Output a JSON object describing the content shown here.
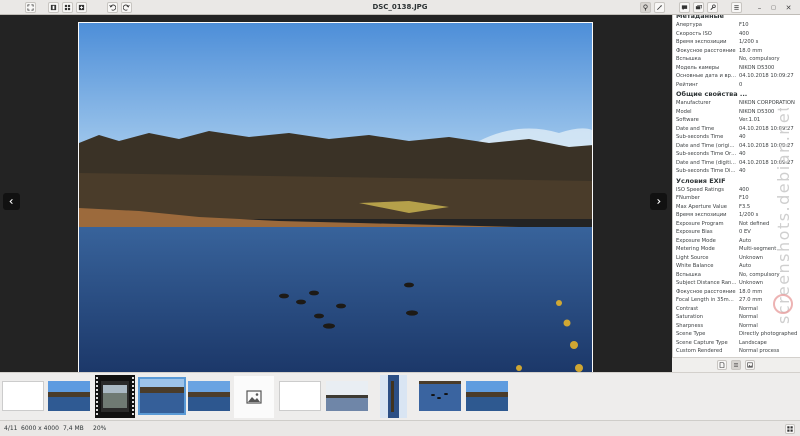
{
  "window": {
    "title": "DSC_0138.JPG"
  },
  "sidebar": {
    "sections": [
      {
        "title": "Метаданные",
        "rows": [
          [
            "Апертура",
            "F10"
          ],
          [
            "Скорость ISO",
            "400"
          ],
          [
            "Время экспозиции",
            "1/200 s"
          ],
          [
            "Фокусное расстояние",
            "18.0 mm"
          ],
          [
            "Вспышка",
            "No, compulsory"
          ],
          [
            "Модель камеры",
            "NIKON D5300"
          ],
          [
            "Основные дата и время",
            "04.10.2018 10:09:27"
          ],
          [
            "Рейтинг",
            "0"
          ]
        ]
      },
      {
        "title": "Общие свойства ...",
        "rows": [
          [
            "Manufacturer",
            "NIKON CORPORATION"
          ],
          [
            "Model",
            "NIKON D5300"
          ],
          [
            "Software",
            "Ver.1.01"
          ],
          [
            "Date and Time",
            "04.10.2018 10:09:27"
          ],
          [
            "Sub-seconds Time",
            "40"
          ],
          [
            "Date and Time (original)",
            "04.10.2018 10:09:27"
          ],
          [
            "Sub-seconds Time Orig...",
            "40"
          ],
          [
            "Date and Time (digitized)",
            "04.10.2018 10:09:27"
          ],
          [
            "Sub-seconds Time Digit...",
            "40"
          ]
        ]
      },
      {
        "title": "Условия EXIF",
        "rows": [
          [
            "ISO Speed Ratings",
            "400"
          ],
          [
            "FNumber",
            "F10"
          ],
          [
            "Max Aperture Value",
            "F3.5"
          ],
          [
            "Время экспозиции",
            "1/200 s"
          ],
          [
            "Exposure Program",
            "Not defined"
          ],
          [
            "Exposure Bias",
            "0 EV"
          ],
          [
            "Exposure Mode",
            "Auto"
          ],
          [
            "Metering Mode",
            "Multi-segment"
          ],
          [
            "Light Source",
            "Unknown"
          ],
          [
            "White Balance",
            "Auto"
          ],
          [
            "Вспышка",
            "No, compulsory"
          ],
          [
            "Subject Distance Range",
            "Unknown"
          ],
          [
            "Фокусное расстояние",
            "18.0 mm"
          ],
          [
            "Focal Length in 35mm ...",
            "27.0 mm"
          ],
          [
            "Contrast",
            "Normal"
          ],
          [
            "Saturation",
            "Normal"
          ],
          [
            "Sharpness",
            "Normal"
          ],
          [
            "Scene Type",
            "Directly photographed"
          ],
          [
            "Scene Capture Type",
            "Landscape"
          ],
          [
            "Custom Rendered",
            "Normal process"
          ]
        ]
      }
    ]
  },
  "status": {
    "index": "4/11",
    "dimensions": "6000 x 4000",
    "size": "7,4 MB",
    "zoom": "20%"
  },
  "watermark": "screenshots.debian.net",
  "colors": {
    "selection": "#5a9ad6",
    "viewer_bg": "#232323"
  },
  "icons": {
    "header_left": [
      "fullscreen-icon",
      "single-view-icon",
      "grid-view-icon",
      "add-icon",
      "rotate-left-icon",
      "rotate-right-icon"
    ],
    "header_right": [
      "info-icon",
      "edit-icon",
      "comment-icon",
      "share-icon",
      "settings-icon",
      "menu-icon"
    ],
    "sidebar_footer": [
      "page-icon",
      "list-icon",
      "image-icon"
    ]
  }
}
